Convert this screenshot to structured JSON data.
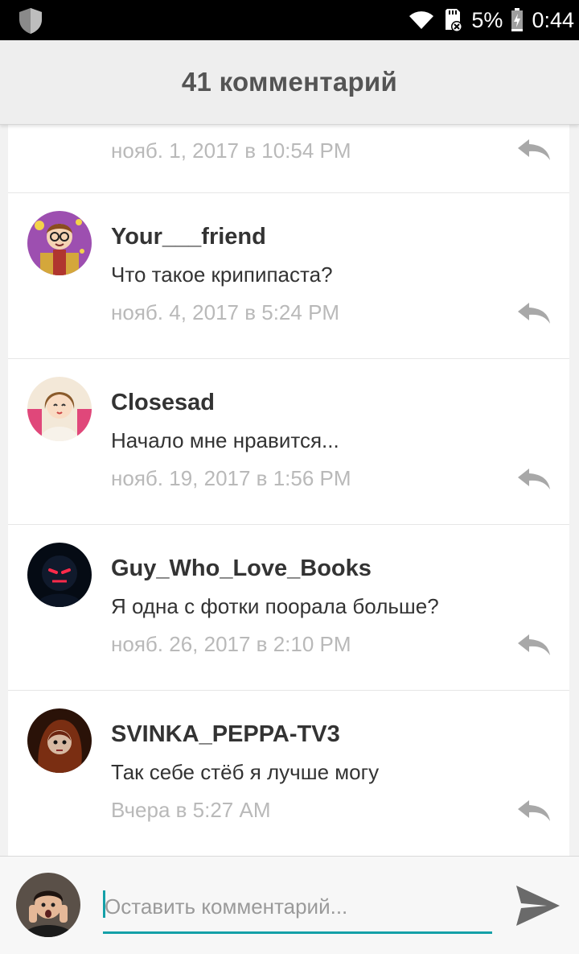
{
  "statusbar": {
    "battery_percent": "5%",
    "time": "0:44"
  },
  "header": {
    "title": "41 комментарий"
  },
  "partial_comment": {
    "date": "нояб. 1, 2017 в 10:54 PM"
  },
  "comments": [
    {
      "author": "Your___friend",
      "text": "Что такое крипипаста?",
      "date": "нояб. 4, 2017 в 5:24 PM"
    },
    {
      "author": "Closesad",
      "text": "Начало мне нравится...",
      "date": "нояб. 19, 2017 в 1:56 PM"
    },
    {
      "author": "Guy_Who_Love_Books",
      "text": "Я одна с фотки поорала больше?",
      "date": "нояб. 26, 2017 в 2:10 PM"
    },
    {
      "author": "SVINKA_PEPPA-TV3",
      "text": "Так себе стёб я лучше могу",
      "date": "Вчера в 5:27 AM"
    }
  ],
  "composer": {
    "placeholder": "Оставить комментарий..."
  },
  "colors": {
    "accent": "#14a0a8",
    "header_bg": "#eeeeee",
    "date_text": "#b9b9b9"
  }
}
